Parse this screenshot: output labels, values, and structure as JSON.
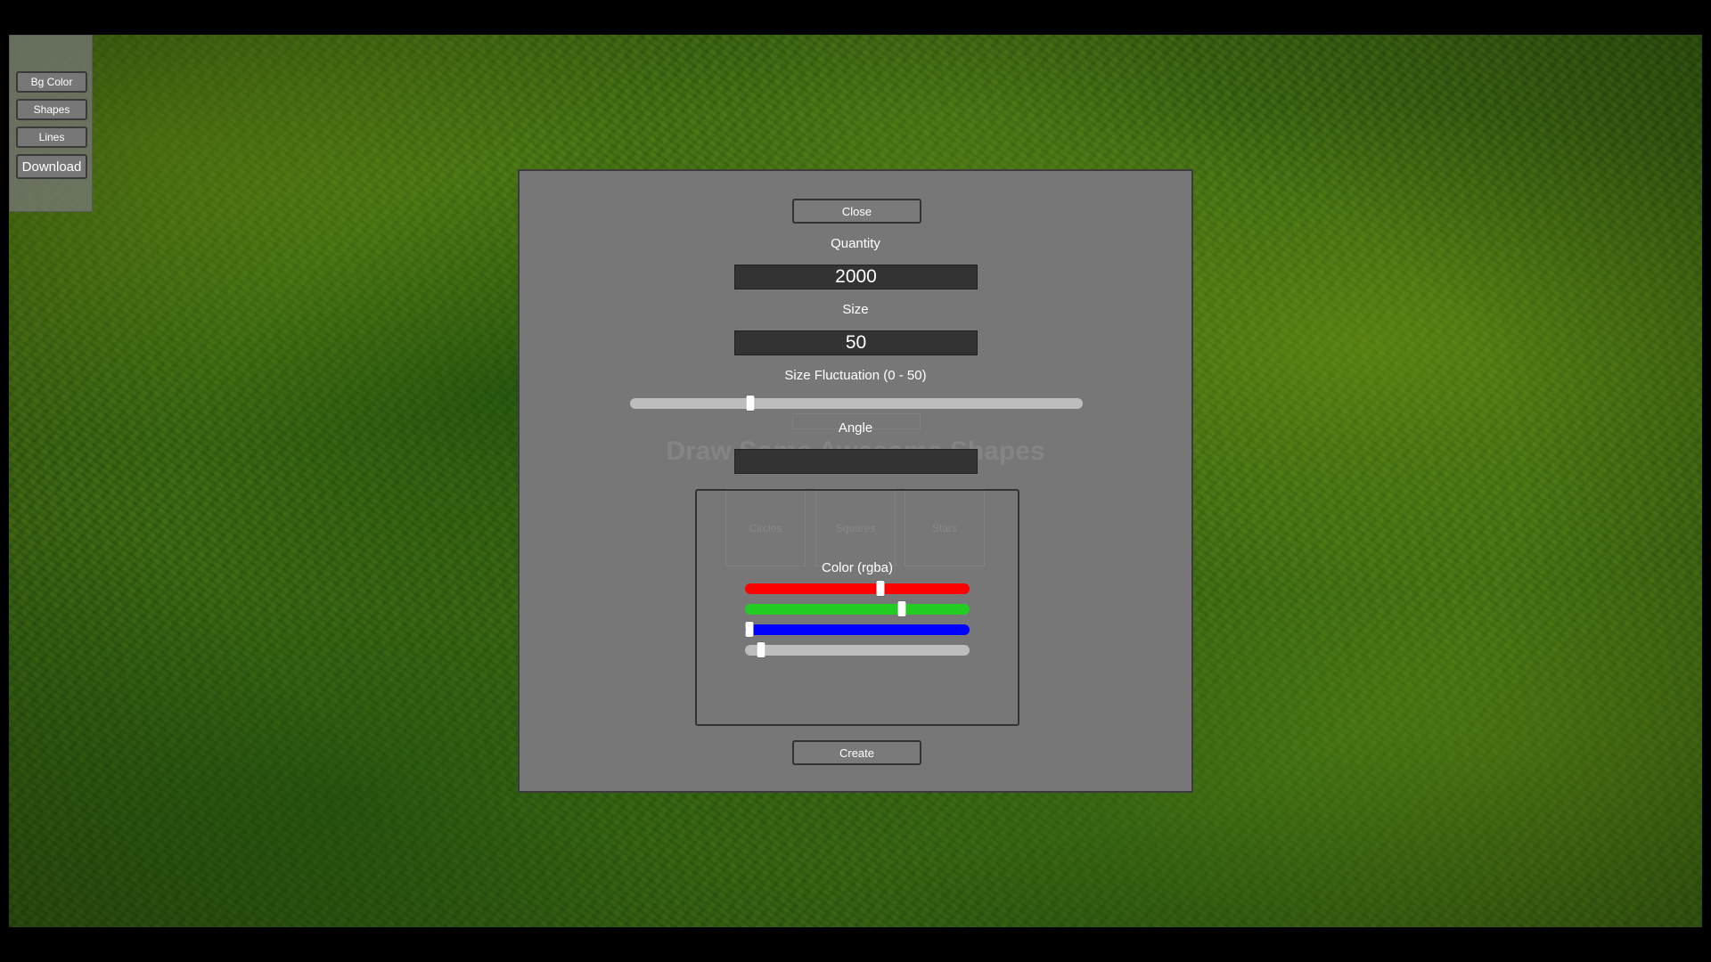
{
  "menu": {
    "bg_color": "Bg Color",
    "shapes": "Shapes",
    "lines": "Lines",
    "download": "Download"
  },
  "modal": {
    "close_label": "Close",
    "quantity_label": "Quantity",
    "quantity_value": "2000",
    "size_label": "Size",
    "size_value": "50",
    "size_fluctuation_label": "Size Fluctuation (0 - 50)",
    "size_fluctuation_fraction": 0.265,
    "angle_label": "Angle",
    "angle_value": "",
    "color_label": "Color (rgba)",
    "color_sliders": [
      {
        "channel": "red",
        "color": "#ff0000",
        "fraction": 0.605
      },
      {
        "channel": "green",
        "color": "#22cc22",
        "fraction": 0.7
      },
      {
        "channel": "blue",
        "color": "#0000ff",
        "fraction": 0.02
      },
      {
        "channel": "alpha",
        "color": "#bdbdbd",
        "fraction": 0.07
      }
    ],
    "create_label": "Create"
  },
  "background_page": {
    "title": "Draw Some Awesome Shapes",
    "options": [
      "Circles",
      "Squares",
      "Stars"
    ]
  },
  "colors": {
    "canvas_green": "#3f6a14",
    "panel_gray": "#777777",
    "input_dark": "#333333"
  }
}
